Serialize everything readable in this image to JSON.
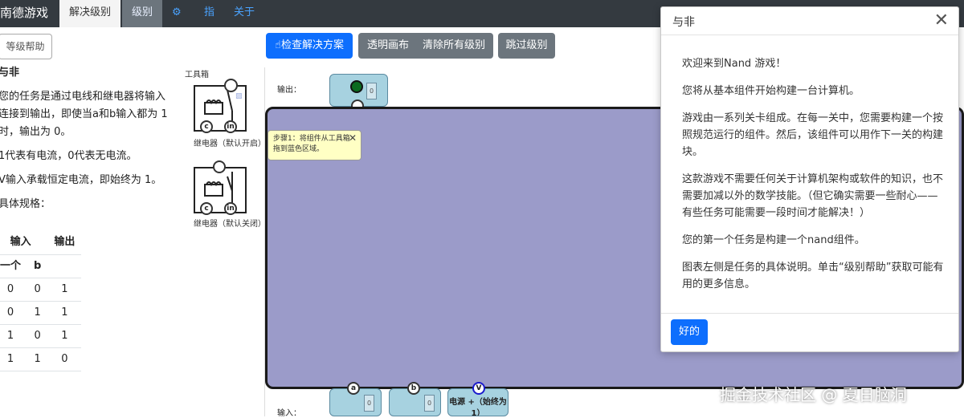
{
  "nav": {
    "brand": "南德游戏",
    "tabs": [
      "解决级别",
      "级别"
    ],
    "gear_icon": "gear-icon",
    "links": [
      "指",
      "关于"
    ]
  },
  "left": {
    "help_button": "等级帮助",
    "level_title": "与非",
    "task_p1": "您的任务是通过电线和继电器将输入连接到输出，即使当a和b输入都为 1 时，输出为 0。",
    "task_p2": "1代表有电流，0代表无电流。",
    "task_p3": "V输入承载恒定电流，即始终为 1。",
    "spec_label": "具体规格：",
    "table": {
      "header1": [
        "输入",
        "输出"
      ],
      "header2": [
        "一个",
        "b"
      ],
      "rows": [
        [
          "0",
          "0",
          "1"
        ],
        [
          "0",
          "1",
          "1"
        ],
        [
          "1",
          "0",
          "1"
        ],
        [
          "1",
          "1",
          "0"
        ]
      ]
    }
  },
  "toolbox": {
    "title": "工具箱",
    "relay1": "继电器（默认开启）",
    "relay2": "继电器（默认关闭）"
  },
  "toolbar": {
    "check": "检查解决方案",
    "transparent": "透明画布",
    "clear": "清除所有级别",
    "skip": "跳过级别"
  },
  "canvas": {
    "output_label": "输出：",
    "input_label": "输入：",
    "tooltip": "步骤1：将组件从工具箱拖到蓝色区域。",
    "pin_a": "a",
    "pin_b": "b",
    "pin_v": "V",
    "power": "电源 +（始终为 1）",
    "zero": "0"
  },
  "modal": {
    "title": "与非",
    "p1": "欢迎来到Nand 游戏！",
    "p2": "您将从基本组件开始构建一台计算机。",
    "p3": "游戏由一系列关卡组成。在每一关中，您需要构建一个按照规范运行的组件。然后，该组件可以用作下一关的构建块。",
    "p4": "这款游戏不需要任何关于计算机架构或软件的知识，也不需要加减以外的数学技能。（但它确实需要一些耐心——有些任务可能需要一段时间才能解决！）",
    "p5": "您的第一个任务是构建一个nand组件。",
    "p6": "图表左侧是任务的具体说明。单击“级别帮助”获取可能有用的更多信息。",
    "ok": "好的"
  },
  "watermark": "掘金技术社区 @ 夏日脑洞",
  "colors": {
    "canvas": "#9b9bc9",
    "primary": "#0d6efd",
    "nav": "#343a40",
    "port": "#a7d2e0"
  }
}
